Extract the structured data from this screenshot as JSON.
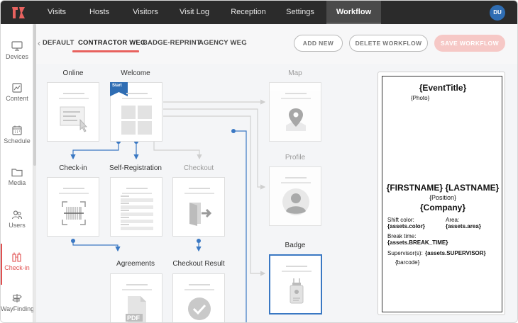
{
  "topnav": {
    "items": [
      "Visits",
      "Hosts",
      "Visitors",
      "Visit Log",
      "Reception",
      "Settings",
      "Workflow"
    ],
    "active": "Workflow",
    "user_initials": "DU"
  },
  "sidebar": {
    "items": [
      {
        "label": "Devices",
        "icon": "monitor-icon"
      },
      {
        "label": "Content",
        "icon": "content-icon"
      },
      {
        "label": "Schedule",
        "icon": "calendar-icon"
      },
      {
        "label": "Media",
        "icon": "folder-icon"
      },
      {
        "label": "Users",
        "icon": "users-icon"
      },
      {
        "label": "Check-in",
        "icon": "checkin-icon"
      },
      {
        "label": "WayFinding",
        "icon": "signpost-icon"
      }
    ],
    "active": "Check-in"
  },
  "tabs": {
    "items": [
      "DEFAULT",
      "CONTRACTOR WEC",
      "BADGE-REPRINT",
      "AGENCY WEC"
    ],
    "active": "CONTRACTOR WEC"
  },
  "actions": {
    "add_new": "ADD NEW",
    "delete_workflow": "DELETE WORKFLOW",
    "save_workflow": "SAVE WORKFLOW"
  },
  "workflow": {
    "nodes": {
      "online": "Online",
      "welcome": "Welcome",
      "map": "Map",
      "checkin": "Check-in",
      "self_registration": "Self-Registration",
      "checkout": "Checkout",
      "profile": "Profile",
      "badge": "Badge",
      "agreements": "Agreements",
      "checkout_result": "Checkout Result"
    },
    "start_tag": "Start"
  },
  "badge_preview": {
    "event_title": "{EventTitle}",
    "photo": "{Photo}",
    "name": "{FIRSTNAME} {LASTNAME}",
    "position": "{Position}",
    "company": "{Company}",
    "shift_label": "Shift color:",
    "shift_value": "{assets.color}",
    "area_label": "Area:",
    "area_value": "{assets.area}",
    "break_label": "Break time:",
    "break_value": "{assets.BREAK_TIME}",
    "supervisor_label": "Supervisor(s):",
    "supervisor_value": "{assets.SUPERVISOR}",
    "barcode": "{barcode}"
  },
  "colors": {
    "accent": "#e8625f",
    "link_blue": "#3a78c3",
    "topbar": "#2b2b2b"
  }
}
